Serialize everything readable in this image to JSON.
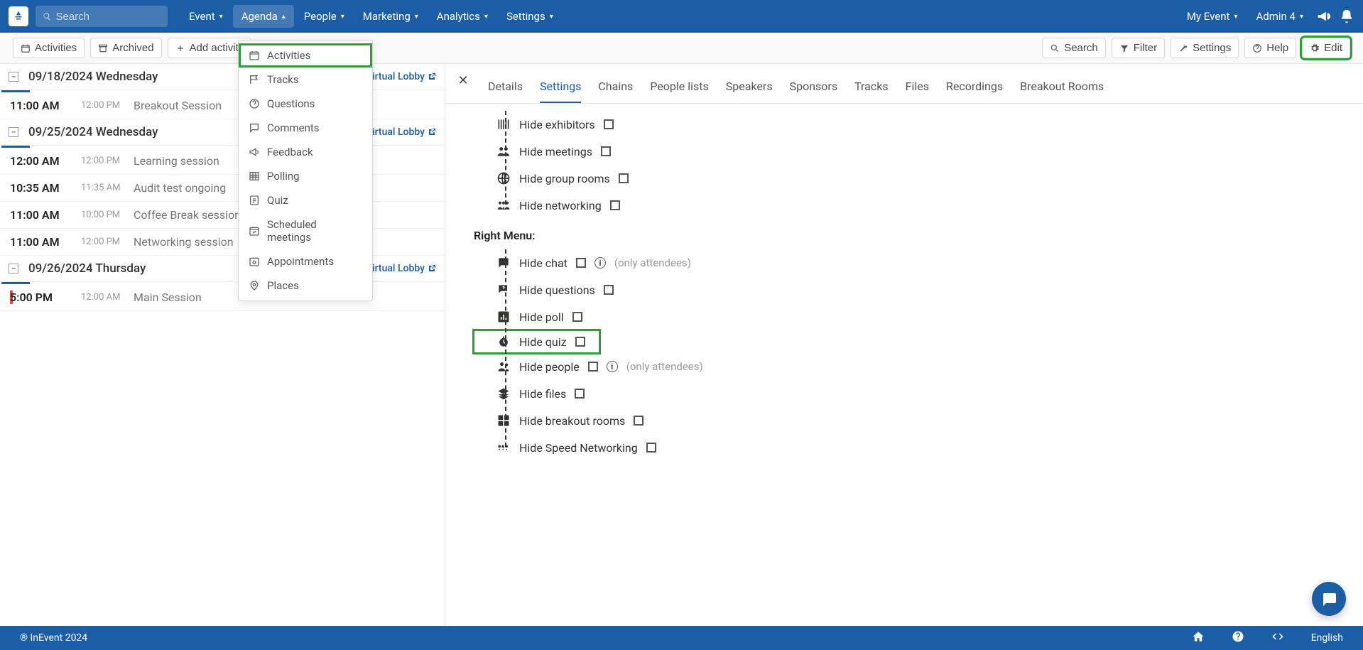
{
  "navbar": {
    "search_placeholder": "Search",
    "menu": [
      {
        "label": "Event"
      },
      {
        "label": "Agenda",
        "active": true
      },
      {
        "label": "People"
      },
      {
        "label": "Marketing"
      },
      {
        "label": "Analytics"
      },
      {
        "label": "Settings"
      }
    ],
    "event_label": "My Event",
    "user_label": "Admin 4"
  },
  "toolbar": {
    "activities": "Activities",
    "archived": "Archived",
    "add_activity": "Add activity",
    "search": "Search",
    "filter": "Filter",
    "settings": "Settings",
    "help": "Help",
    "edit": "Edit"
  },
  "dropdown": [
    {
      "icon": "calendar",
      "label": "Activities",
      "highlight": true
    },
    {
      "icon": "flag",
      "label": "Tracks"
    },
    {
      "icon": "question",
      "label": "Questions"
    },
    {
      "icon": "comment",
      "label": "Comments"
    },
    {
      "icon": "bullhorn",
      "label": "Feedback"
    },
    {
      "icon": "table",
      "label": "Polling"
    },
    {
      "icon": "quiz",
      "label": "Quiz"
    },
    {
      "icon": "calendar2",
      "label": "Scheduled meetings"
    },
    {
      "icon": "appoint",
      "label": "Appointments"
    },
    {
      "icon": "pin",
      "label": "Places"
    }
  ],
  "agenda": [
    {
      "date": "09/18/2024 Wednesday",
      "lobby": "Virtual Lobby",
      "rows": [
        {
          "start": "11:00 AM",
          "end": "12:00 PM",
          "title": "Breakout Session"
        }
      ]
    },
    {
      "date": "09/25/2024 Wednesday",
      "lobby": "Virtual Lobby",
      "rows": [
        {
          "start": "12:00 AM",
          "end": "12:00 PM",
          "title": "Learning session"
        },
        {
          "start": "10:35 AM",
          "end": "11:35 AM",
          "title": "Audit test ongoing"
        },
        {
          "start": "11:00 AM",
          "end": "10:00 PM",
          "title": "Coffee Break session"
        },
        {
          "start": "11:00 AM",
          "end": "12:00 PM",
          "title": "Networking session"
        }
      ]
    },
    {
      "date": "09/26/2024 Thursday",
      "lobby": "Virtual Lobby",
      "red": true,
      "rows": [
        {
          "start": "5:00 PM",
          "end": "12:00 AM",
          "title": "Main Session"
        }
      ]
    }
  ],
  "detail": {
    "tabs": [
      "Details",
      "Settings",
      "Chains",
      "People lists",
      "Speakers",
      "Sponsors",
      "Tracks",
      "Files",
      "Recordings",
      "Breakout Rooms"
    ],
    "active_tab": "Settings",
    "top_rows": [
      {
        "icon": "exhibitors",
        "label": "Hide exhibitors"
      },
      {
        "icon": "meetings",
        "label": "Hide meetings"
      },
      {
        "icon": "globe",
        "label": "Hide group rooms"
      },
      {
        "icon": "networking",
        "label": "Hide networking"
      }
    ],
    "section_title": "Right Menu:",
    "right_rows": [
      {
        "icon": "chat",
        "label": "Hide chat",
        "info": true,
        "hint": "(only attendees)"
      },
      {
        "icon": "questions",
        "label": "Hide questions"
      },
      {
        "icon": "poll",
        "label": "Hide poll"
      },
      {
        "icon": "quiz",
        "label": "Hide quiz",
        "highlight": true
      },
      {
        "icon": "people",
        "label": "Hide people",
        "info": true,
        "hint": "(only attendees)"
      },
      {
        "icon": "files",
        "label": "Hide files"
      },
      {
        "icon": "breakout",
        "label": "Hide breakout rooms"
      },
      {
        "icon": "speed",
        "label": "Hide Speed Networking"
      }
    ]
  },
  "footer": {
    "copyright": "® InEvent 2024",
    "lang": "English"
  }
}
